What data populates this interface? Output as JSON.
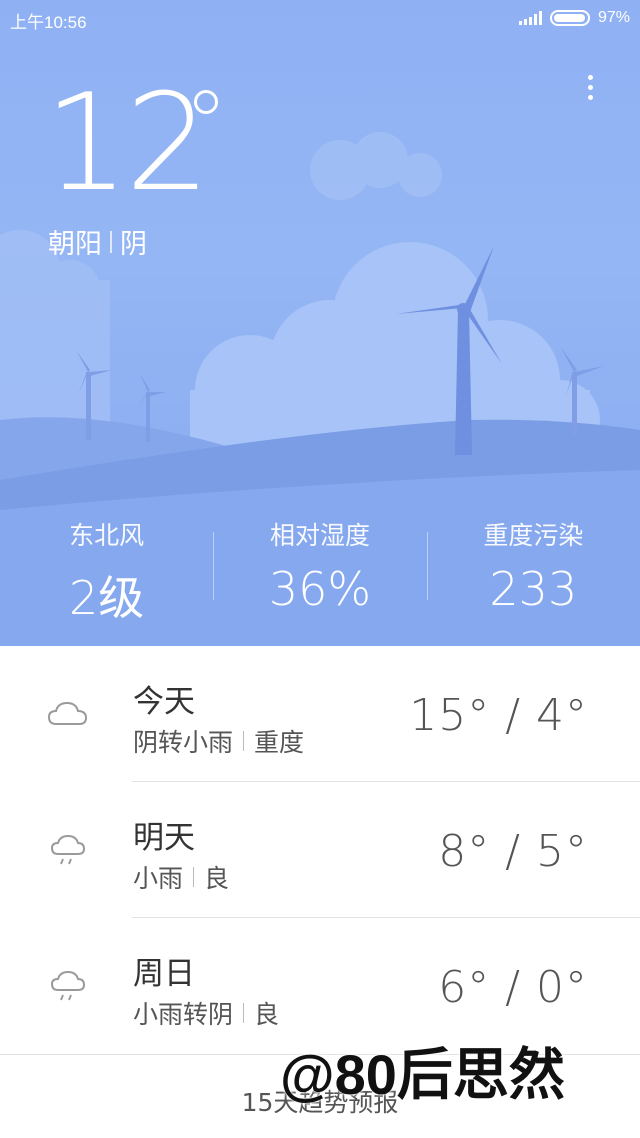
{
  "status_bar": {
    "time": "上午10:56",
    "battery": "97%",
    "battery_icon": "battery-icon",
    "signal_icon": "signal-icon"
  },
  "current": {
    "temperature": "12",
    "city": "朝阳",
    "condition": "阴"
  },
  "stats": [
    {
      "label": "东北风",
      "value": "2级"
    },
    {
      "label": "相对湿度",
      "value": "36%"
    },
    {
      "label": "重度污染",
      "value": "233"
    }
  ],
  "forecast": [
    {
      "day": "今天",
      "condition": "阴转小雨",
      "air": "重度",
      "range": "15° / 4°",
      "icon": "cloud-icon"
    },
    {
      "day": "明天",
      "condition": "小雨",
      "air": "良",
      "range": "8° / 5°",
      "icon": "light-rain-icon"
    },
    {
      "day": "周日",
      "condition": "小雨转阴",
      "air": "良",
      "range": "6° / 0°",
      "icon": "light-rain-icon"
    }
  ],
  "footer": {
    "link": "15天趋势预报"
  },
  "watermark": "@80后思然",
  "colors": {
    "sky_top": "#8fb1f4",
    "sky_bottom": "#86a8ee",
    "hill": "#7f9fe6",
    "turbine": "#6f8fe0"
  }
}
